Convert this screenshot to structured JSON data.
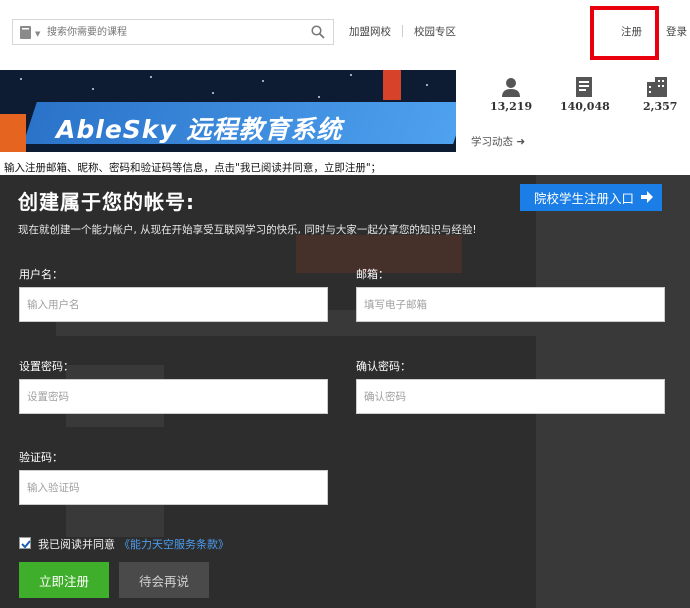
{
  "header": {
    "search_placeholder": "搜索你需要的课程",
    "nav": [
      "加盟网校",
      "校园专区"
    ],
    "register": "注册",
    "login": "登录"
  },
  "banner": {
    "logo_text": "AbleSky 远程教育系统"
  },
  "stats": [
    {
      "icon": "user-icon",
      "value": "13,219"
    },
    {
      "icon": "document-icon",
      "value": "140,048"
    },
    {
      "icon": "building-icon",
      "value": "2,357"
    }
  ],
  "learn_dynamic": "学习动态 ➜",
  "instruction": "输入注册邮箱、昵称、密码和验证码等信息，点击\"我已阅读并同意，立即注册\"；",
  "modal": {
    "title": "创建属于您的帐号:",
    "student_entry": "院校学生注册入口",
    "subtitle": "现在就创建一个能力帐户, 从现在开始享受互联网学习的快乐, 同时与大家一起分享您的知识与经验!",
    "username": {
      "label": "用户名：",
      "placeholder": "输入用户名"
    },
    "email": {
      "label": "邮箱：",
      "placeholder": "填写电子邮箱"
    },
    "password": {
      "label": "设置密码：",
      "placeholder": "设置密码"
    },
    "confirm": {
      "label": "确认密码：",
      "placeholder": "确认密码"
    },
    "captcha": {
      "label": "验证码：",
      "placeholder": "输入验证码"
    },
    "agree_text": "我已阅读并同意",
    "agree_link": "《能力天空服务条款》",
    "register_btn": "立即注册",
    "later_btn": "待会再说"
  },
  "colors": {
    "accent_blue": "#1a7ee6",
    "register_green": "#3fae2a",
    "highlight_red": "#e8000c",
    "overlay": "#2d2d2d"
  }
}
